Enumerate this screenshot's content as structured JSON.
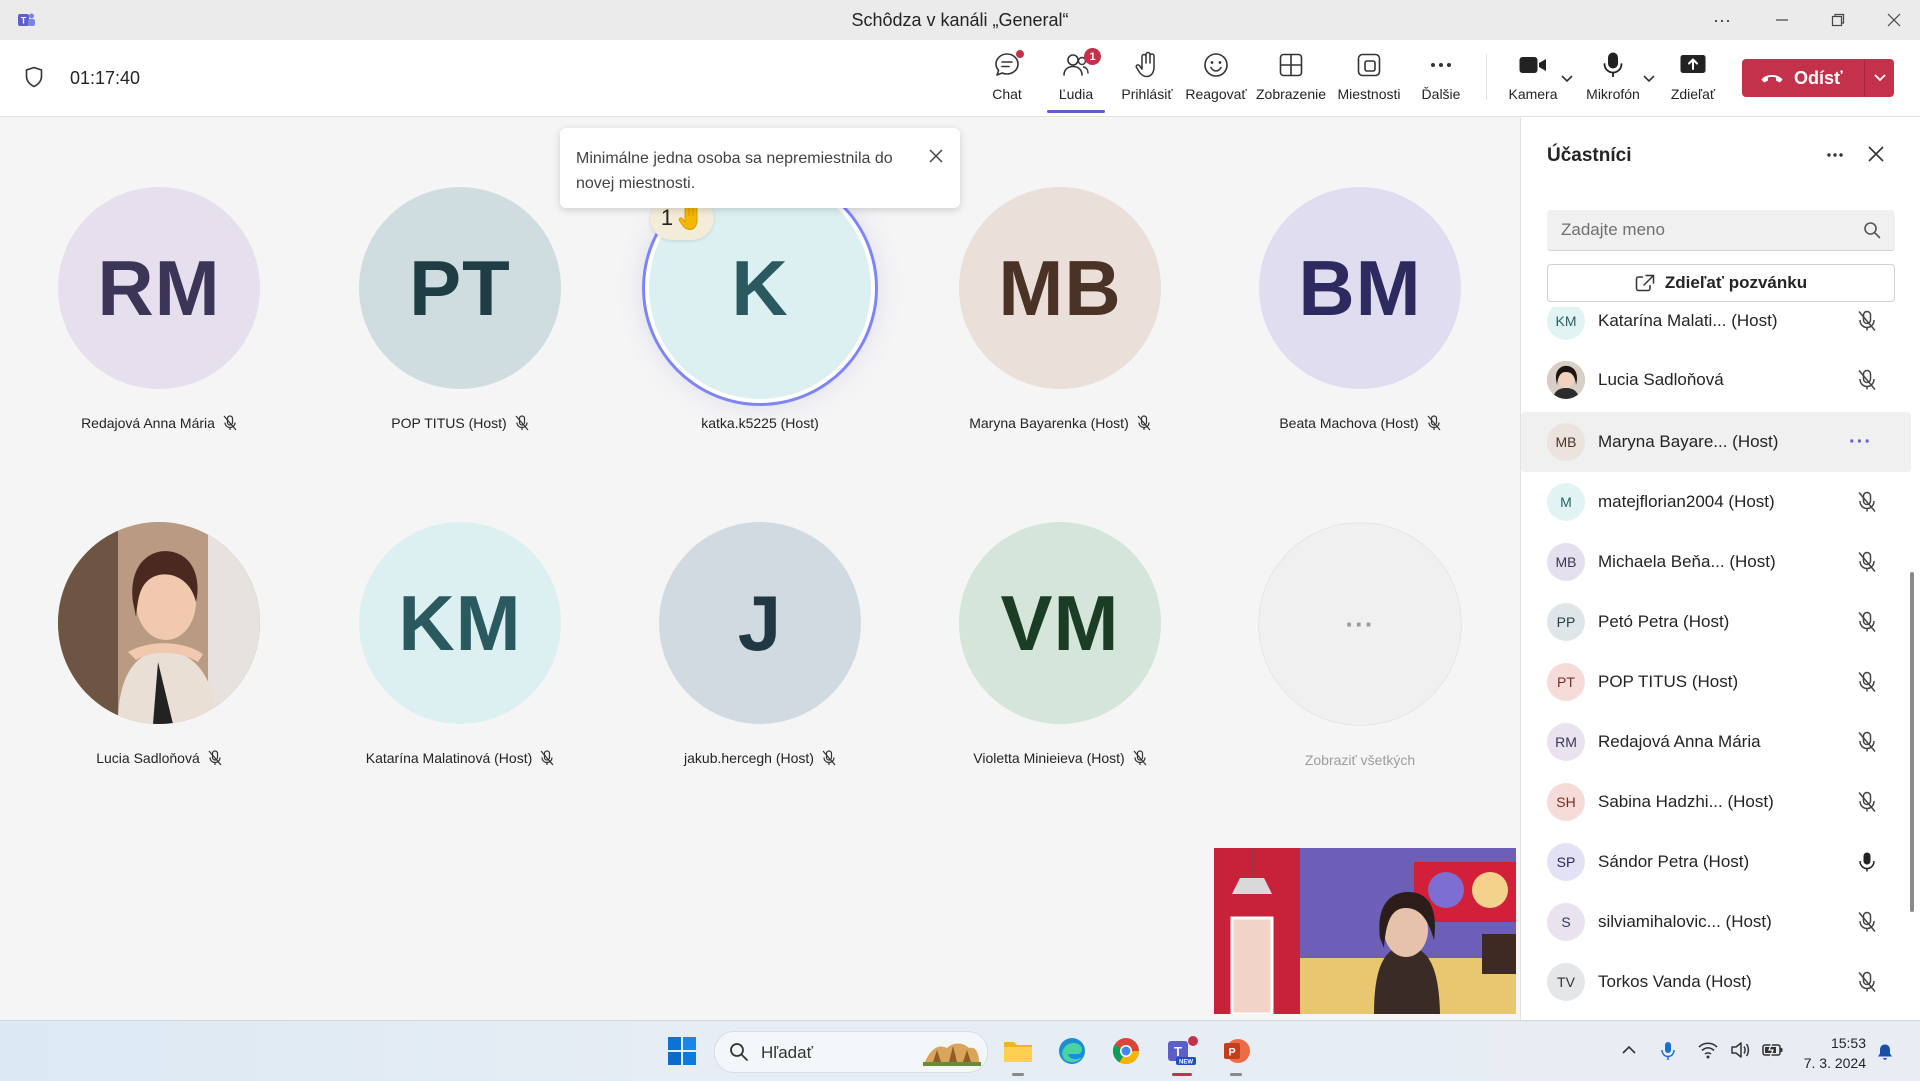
{
  "window": {
    "title": "Schôdza v kanáli „General“"
  },
  "meeting": {
    "timer": "01:17:40"
  },
  "toolbar": {
    "chat": "Chat",
    "people": "Ľudia",
    "people_badge": "1",
    "raise_hand": "Prihlásiť",
    "react": "Reagovať",
    "view": "Zobrazenie",
    "rooms": "Miestnosti",
    "more": "Ďalšie",
    "camera": "Kamera",
    "mic": "Mikrofón",
    "share": "Zdieľať",
    "leave": "Odísť"
  },
  "toast": {
    "text": "Minimálne jedna osoba sa nepremiestnila do novej miestnosti."
  },
  "tiles": [
    {
      "initials": "RM",
      "name": "Redajová Anna Mária",
      "bg": "#e6e0ee",
      "fg": "#3b3558"
    },
    {
      "initials": "PT",
      "name": "POP TITUS (Host)",
      "bg": "#d0dde0",
      "fg": "#1f3d44"
    },
    {
      "initials": "K",
      "name": "katka.k5225 (Host)",
      "bg": "#dcf0f2",
      "fg": "#2a5a60"
    },
    {
      "initials": "MB",
      "name": "Maryna Bayarenka (Host)",
      "bg": "#eadfd9",
      "fg": "#4a3326"
    },
    {
      "initials": "BM",
      "name": "Beata Machova (Host)",
      "bg": "#e0ddf1",
      "fg": "#2c2a5e"
    },
    {
      "initials": "",
      "name": "Lucia Sadloňová",
      "bg": "#c9b4a1",
      "fg": "#333"
    },
    {
      "initials": "KM",
      "name": "Katarína Malatinová (Host)",
      "bg": "#dcf0f2",
      "fg": "#2a5a60"
    },
    {
      "initials": "J",
      "name": "jakub.hercegh (Host)",
      "bg": "#d0dae0",
      "fg": "#1f3844"
    },
    {
      "initials": "VM",
      "name": "Violetta Minieieva (Host)",
      "bg": "#d4e6da",
      "fg": "#1b3d26"
    },
    {
      "initials": "···",
      "name": "Zobraziť všetkých",
      "bg": "#f0f0f0",
      "fg": "#9a9a9a"
    }
  ],
  "raised_hand_count": "1",
  "panel": {
    "title": "Účastníci",
    "search_placeholder": "Zadajte meno",
    "share_invite": "Zdieľať pozvánku",
    "participants": [
      {
        "initials": "KM",
        "name": "Katarína Malati... (Host)",
        "bg": "#e2f3f4",
        "fg": "#2a6068",
        "mic": "muted"
      },
      {
        "initials": "",
        "name": "Lucia Sadloňová",
        "bg": "#b9a294",
        "fg": "#333",
        "mic": "muted"
      },
      {
        "initials": "MB",
        "name": "Maryna Bayare... (Host)",
        "bg": "#ece3de",
        "fg": "#4a3326",
        "mic": "more"
      },
      {
        "initials": "M",
        "name": "matejflorian2004 (Host)",
        "bg": "#e2f3f4",
        "fg": "#2a6068",
        "mic": "muted"
      },
      {
        "initials": "MB",
        "name": "Michaela Beňa... (Host)",
        "bg": "#e4e0ee",
        "fg": "#3b3558",
        "mic": "muted"
      },
      {
        "initials": "PP",
        "name": "Petó Petra (Host)",
        "bg": "#dfe6e8",
        "fg": "#2b3f44",
        "mic": "muted"
      },
      {
        "initials": "PT",
        "name": "POP TITUS (Host)",
        "bg": "#f6dcd8",
        "fg": "#7a2e22",
        "mic": "muted"
      },
      {
        "initials": "RM",
        "name": "Redajová Anna Mária",
        "bg": "#e8e3ee",
        "fg": "#3b3558",
        "mic": "muted"
      },
      {
        "initials": "SH",
        "name": "Sabina Hadzhi... (Host)",
        "bg": "#f6dcd8",
        "fg": "#7a2e22",
        "mic": "muted"
      },
      {
        "initials": "SP",
        "name": "Sándor Petra (Host)",
        "bg": "#e2e2f4",
        "fg": "#2c2a5e",
        "mic": "on"
      },
      {
        "initials": "S",
        "name": "silviamihalovic... (Host)",
        "bg": "#e8e3ee",
        "fg": "#3b3558",
        "mic": "muted"
      },
      {
        "initials": "TV",
        "name": "Torkos Vanda (Host)",
        "bg": "#e4e6e8",
        "fg": "#333",
        "mic": "muted"
      }
    ]
  },
  "taskbar": {
    "search_label": "Hľadať",
    "time": "15:53",
    "date": "7. 3. 2024"
  }
}
